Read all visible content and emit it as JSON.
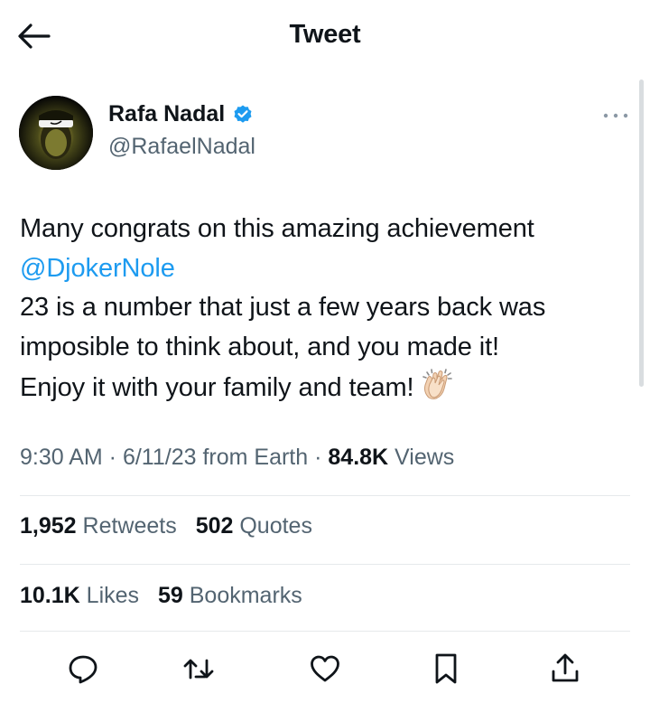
{
  "header": {
    "title": "Tweet",
    "back_icon": "arrow-left-icon"
  },
  "author": {
    "name": "Rafa Nadal",
    "handle": "@RafaelNadal",
    "verified": true,
    "verified_color": "#1d9bf0",
    "more_icon": "more-horizontal-icon"
  },
  "tweet": {
    "line1": "Many congrats on this amazing achievement",
    "mention": "@DjokerNole",
    "line3": "23 is a number that just a few years back was",
    "line4": "imposible to think about, and you made it!",
    "line5": "Enjoy it with your family and team!",
    "emoji": "👏🏻"
  },
  "meta": {
    "time": "9:30 AM",
    "sep1": " · ",
    "date": "6/11/23",
    "source": " from Earth",
    "sep2": " · ",
    "views_count": "84.8K",
    "views_label": " Views"
  },
  "stats": {
    "retweets_count": "1,952",
    "retweets_label": " Retweets",
    "quotes_count": "502",
    "quotes_label": " Quotes",
    "likes_count": "10.1K",
    "likes_label": " Likes",
    "bookmarks_count": "59",
    "bookmarks_label": " Bookmarks"
  },
  "actions": [
    "reply-icon",
    "retweet-icon",
    "like-icon",
    "bookmark-icon",
    "share-icon"
  ],
  "colors": {
    "text": "#0f1419",
    "secondary": "#536471",
    "link": "#1d9bf0",
    "divider": "#e6e9eb"
  }
}
